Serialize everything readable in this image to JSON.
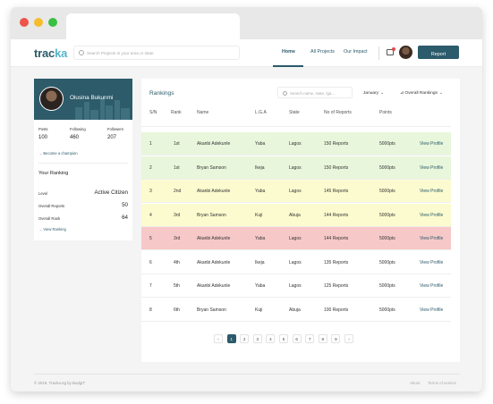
{
  "window": {
    "dots": {
      "close": "#f0534a",
      "minimize": "#f5bd2d",
      "maximize": "#39c041"
    }
  },
  "nav": {
    "logo_main": "trac",
    "logo_accent": "ka",
    "search_placeholder": "Search Projects in your area or state",
    "links": [
      {
        "label": "Home",
        "active": true
      },
      {
        "label": "All Projects",
        "active": false
      },
      {
        "label": "Our Impact",
        "active": false
      }
    ],
    "report_label": "Report",
    "colors": {
      "brand": "#2c5b6b",
      "accent": "#55b5c8",
      "notification": "#e14b4b"
    }
  },
  "profile": {
    "name": "Olusina Bukunmi",
    "stats": [
      {
        "label": "Posts",
        "value": "100"
      },
      {
        "label": "Following",
        "value": "460"
      },
      {
        "label": "Followers",
        "value": "207"
      }
    ],
    "become_champion": "Become a champion",
    "your_ranking": {
      "title": "Your Ranking",
      "level_label": "Level",
      "level_value": "Active Citizen",
      "reports_label": "Overall Reports",
      "reports_value": "50",
      "rank_label": "Overall Rank",
      "rank_value": "64"
    },
    "view_ranking": "View Ranking"
  },
  "rankings": {
    "title": "Rankings",
    "search_placeholder": "Search name, state, lga...",
    "month_filter": "January",
    "type_filter": "Overall Rankings",
    "columns": [
      "S/N",
      "Rank",
      "Name",
      "L.G.A",
      "State",
      "No of Reports",
      "Points"
    ],
    "action_label": "View Profile",
    "row_colors": {
      "green": "#e8f6db",
      "yellow": "#fbfbcf",
      "red": "#f7c8c8",
      "none": "#ffffff"
    },
    "rows": [
      {
        "sn": "1",
        "rank": "1st",
        "name": "Akanbi  Adekunle",
        "lga": "Yaba",
        "state": "Lagos",
        "reports": "150 Reports",
        "points": "5000pts",
        "color": "green"
      },
      {
        "sn": "2",
        "rank": "1st",
        "name": "Bryan Samson",
        "lga": "Ikeja",
        "state": "Lagos",
        "reports": "150 Reports",
        "points": "5000pts",
        "color": "green"
      },
      {
        "sn": "3",
        "rank": "2nd",
        "name": "Akanbi  Adekunle",
        "lga": "Yaba",
        "state": "Lagos",
        "reports": "145 Reports",
        "points": "5000pts",
        "color": "yellow"
      },
      {
        "sn": "4",
        "rank": "3rd",
        "name": "Bryan Samson",
        "lga": "Kuji",
        "state": "Abuja",
        "reports": "144 Reports",
        "points": "5000pts",
        "color": "yellow"
      },
      {
        "sn": "5",
        "rank": "3rd",
        "name": "Akanbi  Adekunle",
        "lga": "Yaba",
        "state": "Lagos",
        "reports": "144 Reports",
        "points": "5000pts",
        "color": "red"
      },
      {
        "sn": "6",
        "rank": "4th",
        "name": "Akanbi  Adekunle",
        "lga": "Ikeja",
        "state": "Lagos",
        "reports": "135 Reports",
        "points": "5000pts",
        "color": "none"
      },
      {
        "sn": "7",
        "rank": "5th",
        "name": "Akanbi  Adekunle",
        "lga": "Yaba",
        "state": "Lagos",
        "reports": "125 Reports",
        "points": "5000pts",
        "color": "none"
      },
      {
        "sn": "8",
        "rank": "6th",
        "name": "Bryan Samson",
        "lga": "Kuji",
        "state": "Abuja",
        "reports": "100 Reports",
        "points": "5000pts",
        "color": "none"
      }
    ],
    "pagination": {
      "prev": "‹",
      "next": "›",
      "pages": [
        "1",
        "2",
        "3",
        "4",
        "5",
        "6",
        "7",
        "8",
        "9"
      ],
      "current": "1"
    }
  },
  "footer": {
    "copyright": "© 2019. Tracka.ng by BudgIT",
    "links": [
      "About",
      "Terms of service"
    ]
  }
}
